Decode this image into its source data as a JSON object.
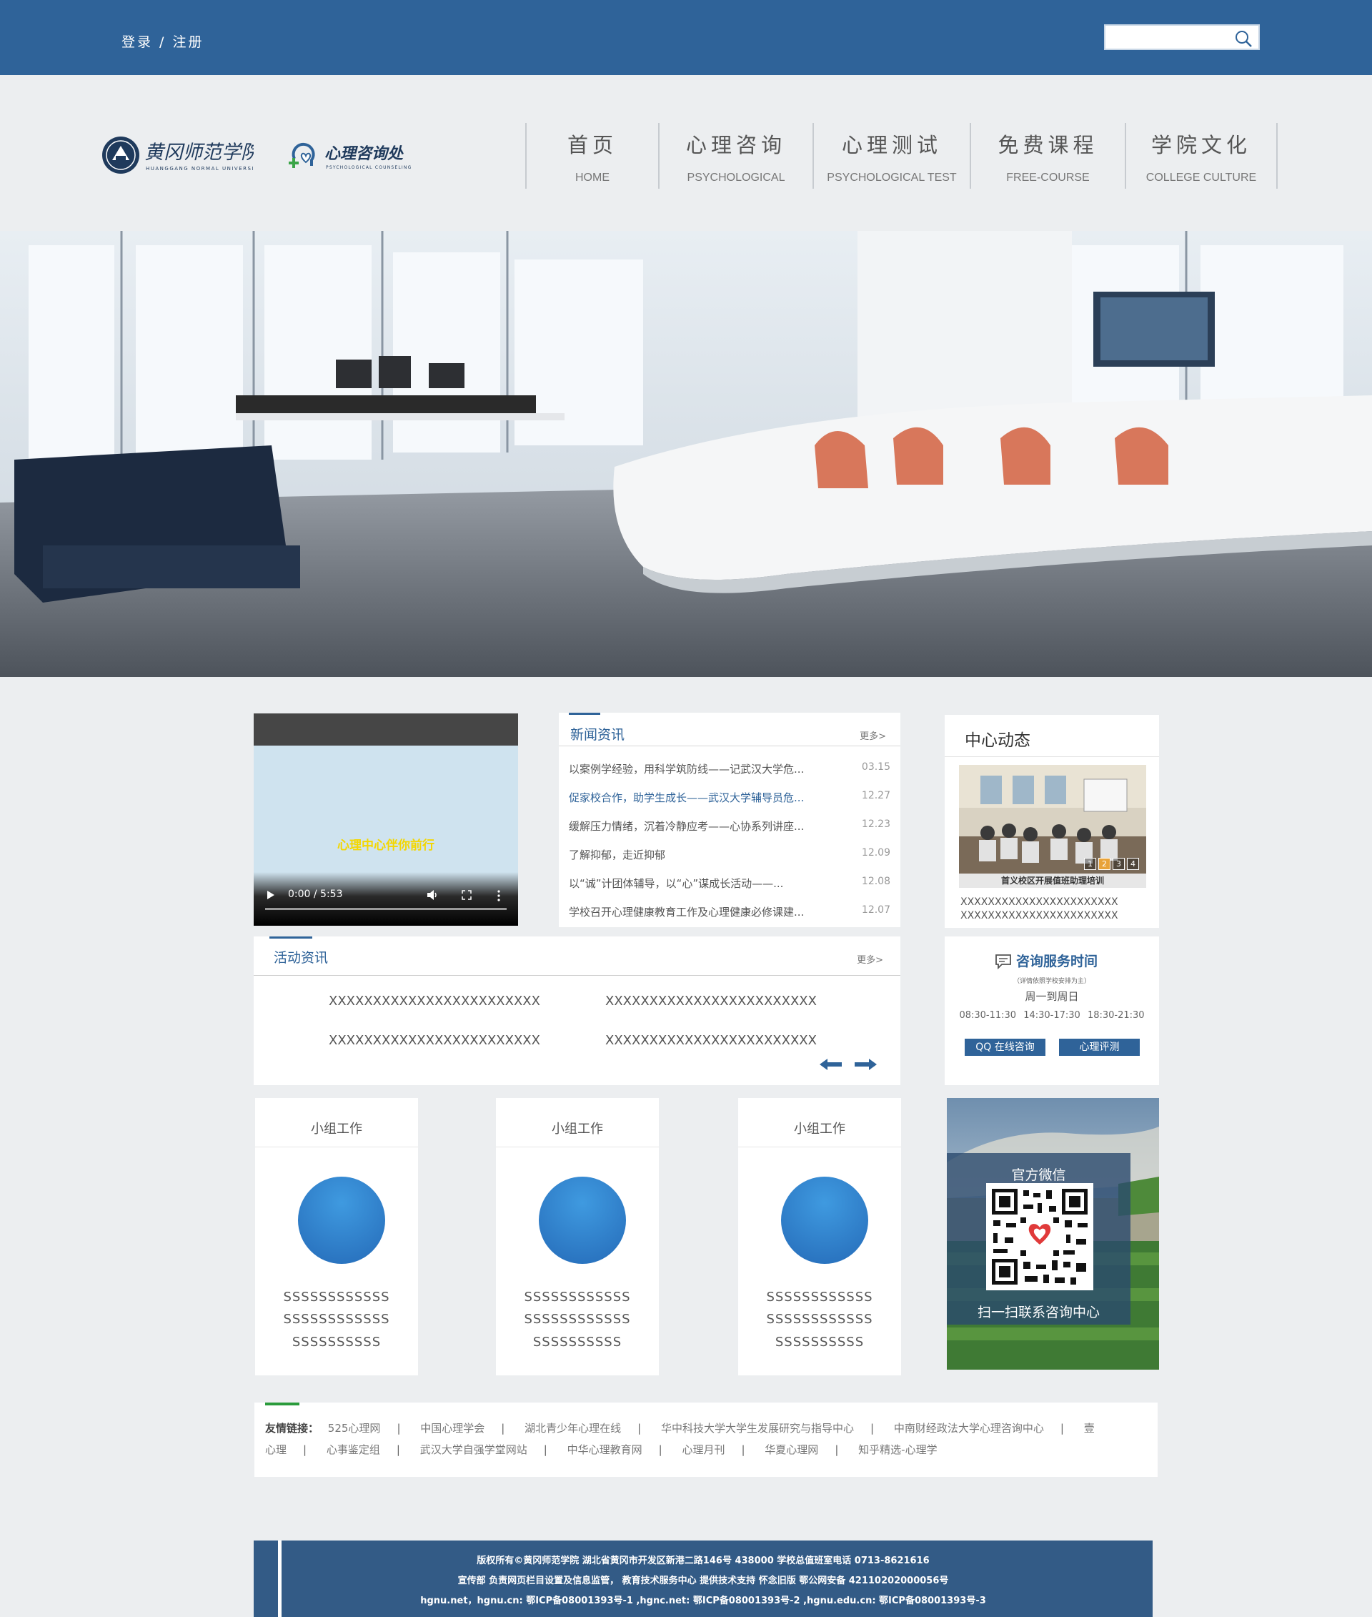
{
  "topbar": {
    "login_label": "登录 / 注册",
    "search_placeholder": ""
  },
  "logos": {
    "university_name_cn": "黄冈师范学院",
    "university_name_en": "HUANGGANG NORMAL UNIVERSITY",
    "counseling_name_cn": "心理咨询处",
    "counseling_name_en": "PSYCHOLOGICAL COUNSELING"
  },
  "nav": {
    "items": [
      {
        "cn": "首页",
        "en": "HOME"
      },
      {
        "cn": "心理咨询",
        "en": "PSYCHOLOGICAL"
      },
      {
        "cn": "心理测试",
        "en": "PSYCHOLOGICAL TEST"
      },
      {
        "cn": "免费课程",
        "en": "FREE-COURSE"
      },
      {
        "cn": "学院文化",
        "en": "COLLEGE CULTURE"
      }
    ]
  },
  "video": {
    "caption": "心理中心伴你前行",
    "time": "0:00 / 5:53"
  },
  "news": {
    "title": "新闻资讯",
    "more": "更多>",
    "items": [
      {
        "title": "以案例学经验，用科学筑防线——记武汉大学危...",
        "date": "03.15"
      },
      {
        "title": "促家校合作，助学生成长——武汉大学辅导员危...",
        "date": "12.27"
      },
      {
        "title": "缓解压力情绪，沉着冷静应考——心协系列讲座...",
        "date": "12.23"
      },
      {
        "title": "了解抑郁，走近抑郁",
        "date": "12.09"
      },
      {
        "title": "以“诚”计团体辅导，以“心”谋成长活动——...",
        "date": "12.08"
      },
      {
        "title": "学校召开心理健康教育工作及心理健康必修课建...",
        "date": "12.07"
      }
    ]
  },
  "dynamics": {
    "title": "中心动态",
    "image_caption": "首义校区开展值班助理培训",
    "pages": [
      "1",
      "2",
      "3",
      "4"
    ],
    "text_line1": "XXXXXXXXXXXXXXXXXXXXXXX",
    "text_line2": "XXXXXXXXXXXXXXXXXXXXXXX"
  },
  "activity": {
    "title": "活动资讯",
    "more": "更多>",
    "items": [
      "XXXXXXXXXXXXXXXXXXXXXXXX",
      "XXXXXXXXXXXXXXXXXXXXXXXX",
      "XXXXXXXXXXXXXXXXXXXXXXXX",
      "XXXXXXXXXXXXXXXXXXXXXXXX"
    ]
  },
  "service": {
    "title": "咨询服务时间",
    "note": "（详情依照学校安排为主）",
    "days": "周一到周日",
    "times": "08:30-11:30 14:30-17:30 18:30-21:30",
    "qq_button": "QQ 在线咨询",
    "eval_button": "心理评测"
  },
  "groups": [
    {
      "title": "小组工作",
      "line1": "SSSSSSSSSSSS",
      "line2": "SSSSSSSSSSSS",
      "line3": "SSSSSSSSSS"
    },
    {
      "title": "小组工作",
      "line1": "SSSSSSSSSSSS",
      "line2": "SSSSSSSSSSSS",
      "line3": "SSSSSSSSSS"
    },
    {
      "title": "小组工作",
      "line1": "SSSSSSSSSSSS",
      "line2": "SSSSSSSSSSSS",
      "line3": "SSSSSSSSSS"
    }
  ],
  "wechat": {
    "title": "官方微信",
    "subtitle": "扫一扫联系咨询中心"
  },
  "links": {
    "label": "友情链接：",
    "row1": [
      "525心理网",
      "中国心理学会",
      "湖北青少年心理在线",
      "华中科技大学大学生发展研究与指导中心",
      "中南财经政法大学心理咨询中心",
      "壹"
    ],
    "row2": [
      "心理",
      "心事鉴定组",
      "武汉大学自强学堂网站",
      "中华心理教育网",
      "心理月刊",
      "华夏心理网",
      "知乎精选-心理学"
    ]
  },
  "footer": {
    "line1": "版权所有©黄冈师范学院 湖北省黄冈市开发区新港二路146号 438000 学校总值班室电话 0713-8621616",
    "line2": "宣传部 负责网页栏目设置及信息监管， 教育技术服务中心 提供技术支持  怀念旧版  鄂公网安备 42110202000056号",
    "line3": "hgnu.net，hgnu.cn: 鄂ICP备08001393号-1 ,hgnc.net: 鄂ICP备08001393号-2 ,hgnu.edu.cn: 鄂ICP备08001393号-3"
  },
  "colors": {
    "brand_blue": "#2f6399",
    "page_bg": "#eceef0",
    "accent_green": "#2a9b3b",
    "footer_bg": "#335b86"
  }
}
